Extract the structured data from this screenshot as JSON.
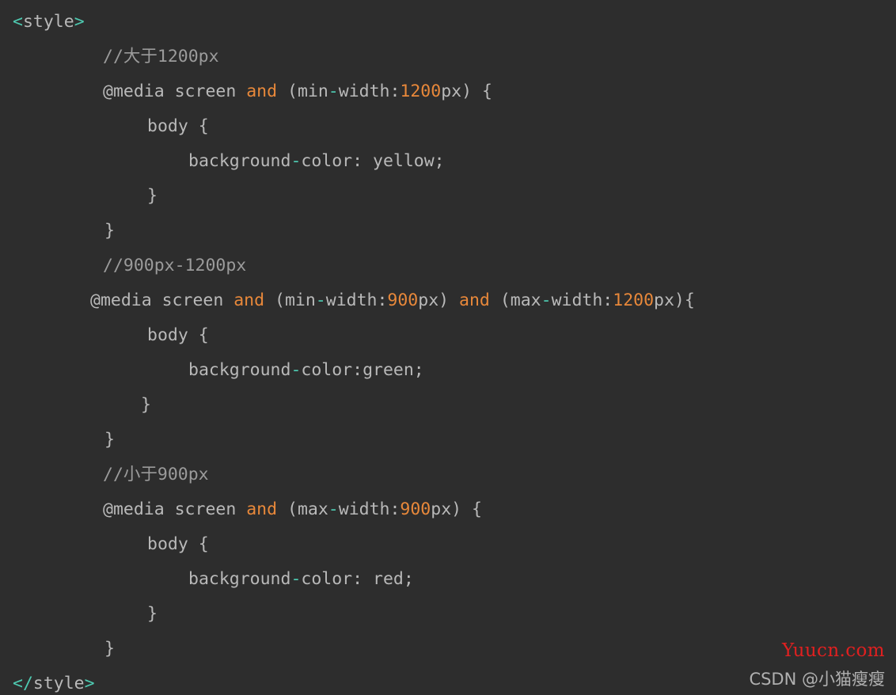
{
  "editor": {
    "background_color": "#2d2d2d",
    "default_text_color": "#b9b9b9",
    "punct_color": "#4ec9b0",
    "keyword_color": "#e8883a",
    "number_color": "#e8883a",
    "comment_color": "#9b9b9b"
  },
  "code": {
    "language": "css",
    "lines": [
      {
        "indent": 0,
        "tokens": [
          {
            "t": "<",
            "c": "punct"
          },
          {
            "t": "style",
            "c": "plain"
          },
          {
            "t": ">",
            "c": "punct"
          }
        ]
      },
      {
        "indent": 114,
        "tokens": [
          {
            "t": "//",
            "c": "comment"
          },
          {
            "t": "大于",
            "c": "comment-cjk"
          },
          {
            "t": "1200px",
            "c": "comment"
          }
        ]
      },
      {
        "indent": 114,
        "tokens": [
          {
            "t": "@media screen ",
            "c": "plain"
          },
          {
            "t": "and",
            "c": "kw"
          },
          {
            "t": " (min",
            "c": "plain"
          },
          {
            "t": "-",
            "c": "punct"
          },
          {
            "t": "width:",
            "c": "plain"
          },
          {
            "t": "1200",
            "c": "num"
          },
          {
            "t": "px) {",
            "c": "plain"
          }
        ]
      },
      {
        "indent": 170,
        "tokens": [
          {
            "t": "body {",
            "c": "plain"
          }
        ]
      },
      {
        "indent": 222,
        "tokens": [
          {
            "t": "background",
            "c": "plain"
          },
          {
            "t": "-",
            "c": "punct"
          },
          {
            "t": "color: yellow;",
            "c": "plain"
          }
        ]
      },
      {
        "indent": 170,
        "tokens": [
          {
            "t": "}",
            "c": "plain"
          }
        ]
      },
      {
        "indent": 116,
        "tokens": [
          {
            "t": "}",
            "c": "plain"
          }
        ]
      },
      {
        "indent": 114,
        "tokens": [
          {
            "t": "//900px-1200px",
            "c": "comment"
          }
        ]
      },
      {
        "indent": 98,
        "tokens": [
          {
            "t": "@media screen ",
            "c": "plain"
          },
          {
            "t": "and",
            "c": "kw"
          },
          {
            "t": " (min",
            "c": "plain"
          },
          {
            "t": "-",
            "c": "punct"
          },
          {
            "t": "width:",
            "c": "plain"
          },
          {
            "t": "900",
            "c": "num"
          },
          {
            "t": "px) ",
            "c": "plain"
          },
          {
            "t": "and",
            "c": "kw"
          },
          {
            "t": " (max",
            "c": "plain"
          },
          {
            "t": "-",
            "c": "punct"
          },
          {
            "t": "width:",
            "c": "plain"
          },
          {
            "t": "1200",
            "c": "num"
          },
          {
            "t": "px){",
            "c": "plain"
          }
        ]
      },
      {
        "indent": 170,
        "tokens": [
          {
            "t": "body {",
            "c": "plain"
          }
        ]
      },
      {
        "indent": 222,
        "tokens": [
          {
            "t": "background",
            "c": "plain"
          },
          {
            "t": "-",
            "c": "punct"
          },
          {
            "t": "color:green;",
            "c": "plain"
          }
        ]
      },
      {
        "indent": 162,
        "tokens": [
          {
            "t": "}",
            "c": "plain"
          }
        ]
      },
      {
        "indent": 116,
        "tokens": [
          {
            "t": "}",
            "c": "plain"
          }
        ]
      },
      {
        "indent": 114,
        "tokens": [
          {
            "t": "//",
            "c": "comment"
          },
          {
            "t": "小于",
            "c": "comment-cjk"
          },
          {
            "t": "900px",
            "c": "comment"
          }
        ]
      },
      {
        "indent": 114,
        "tokens": [
          {
            "t": "@media screen ",
            "c": "plain"
          },
          {
            "t": "and",
            "c": "kw"
          },
          {
            "t": " (max",
            "c": "plain"
          },
          {
            "t": "-",
            "c": "punct"
          },
          {
            "t": "width:",
            "c": "plain"
          },
          {
            "t": "900",
            "c": "num"
          },
          {
            "t": "px) {",
            "c": "plain"
          }
        ]
      },
      {
        "indent": 170,
        "tokens": [
          {
            "t": "body {",
            "c": "plain"
          }
        ]
      },
      {
        "indent": 222,
        "tokens": [
          {
            "t": "background",
            "c": "plain"
          },
          {
            "t": "-",
            "c": "punct"
          },
          {
            "t": "color: red;",
            "c": "plain"
          }
        ]
      },
      {
        "indent": 170,
        "tokens": [
          {
            "t": "}",
            "c": "plain"
          }
        ]
      },
      {
        "indent": 116,
        "tokens": [
          {
            "t": "}",
            "c": "plain"
          }
        ]
      },
      {
        "indent": 0,
        "tokens": [
          {
            "t": "</",
            "c": "punct"
          },
          {
            "t": "style",
            "c": "plain"
          },
          {
            "t": ">",
            "c": "punct"
          }
        ]
      }
    ]
  },
  "gutter": {
    "visible_fragments": [
      "",
      "",
      "",
      "",
      "",
      "",
      "",
      "",
      "",
      "",
      "",
      "",
      "",
      "",
      "",
      "",
      "",
      "",
      "",
      ""
    ]
  },
  "watermarks": {
    "yuucn": "Yuucn.com",
    "yuucn_color": "#e02020",
    "csdn": "CSDN @小猫瘦瘦",
    "csdn_color": "#b0b0b0"
  }
}
